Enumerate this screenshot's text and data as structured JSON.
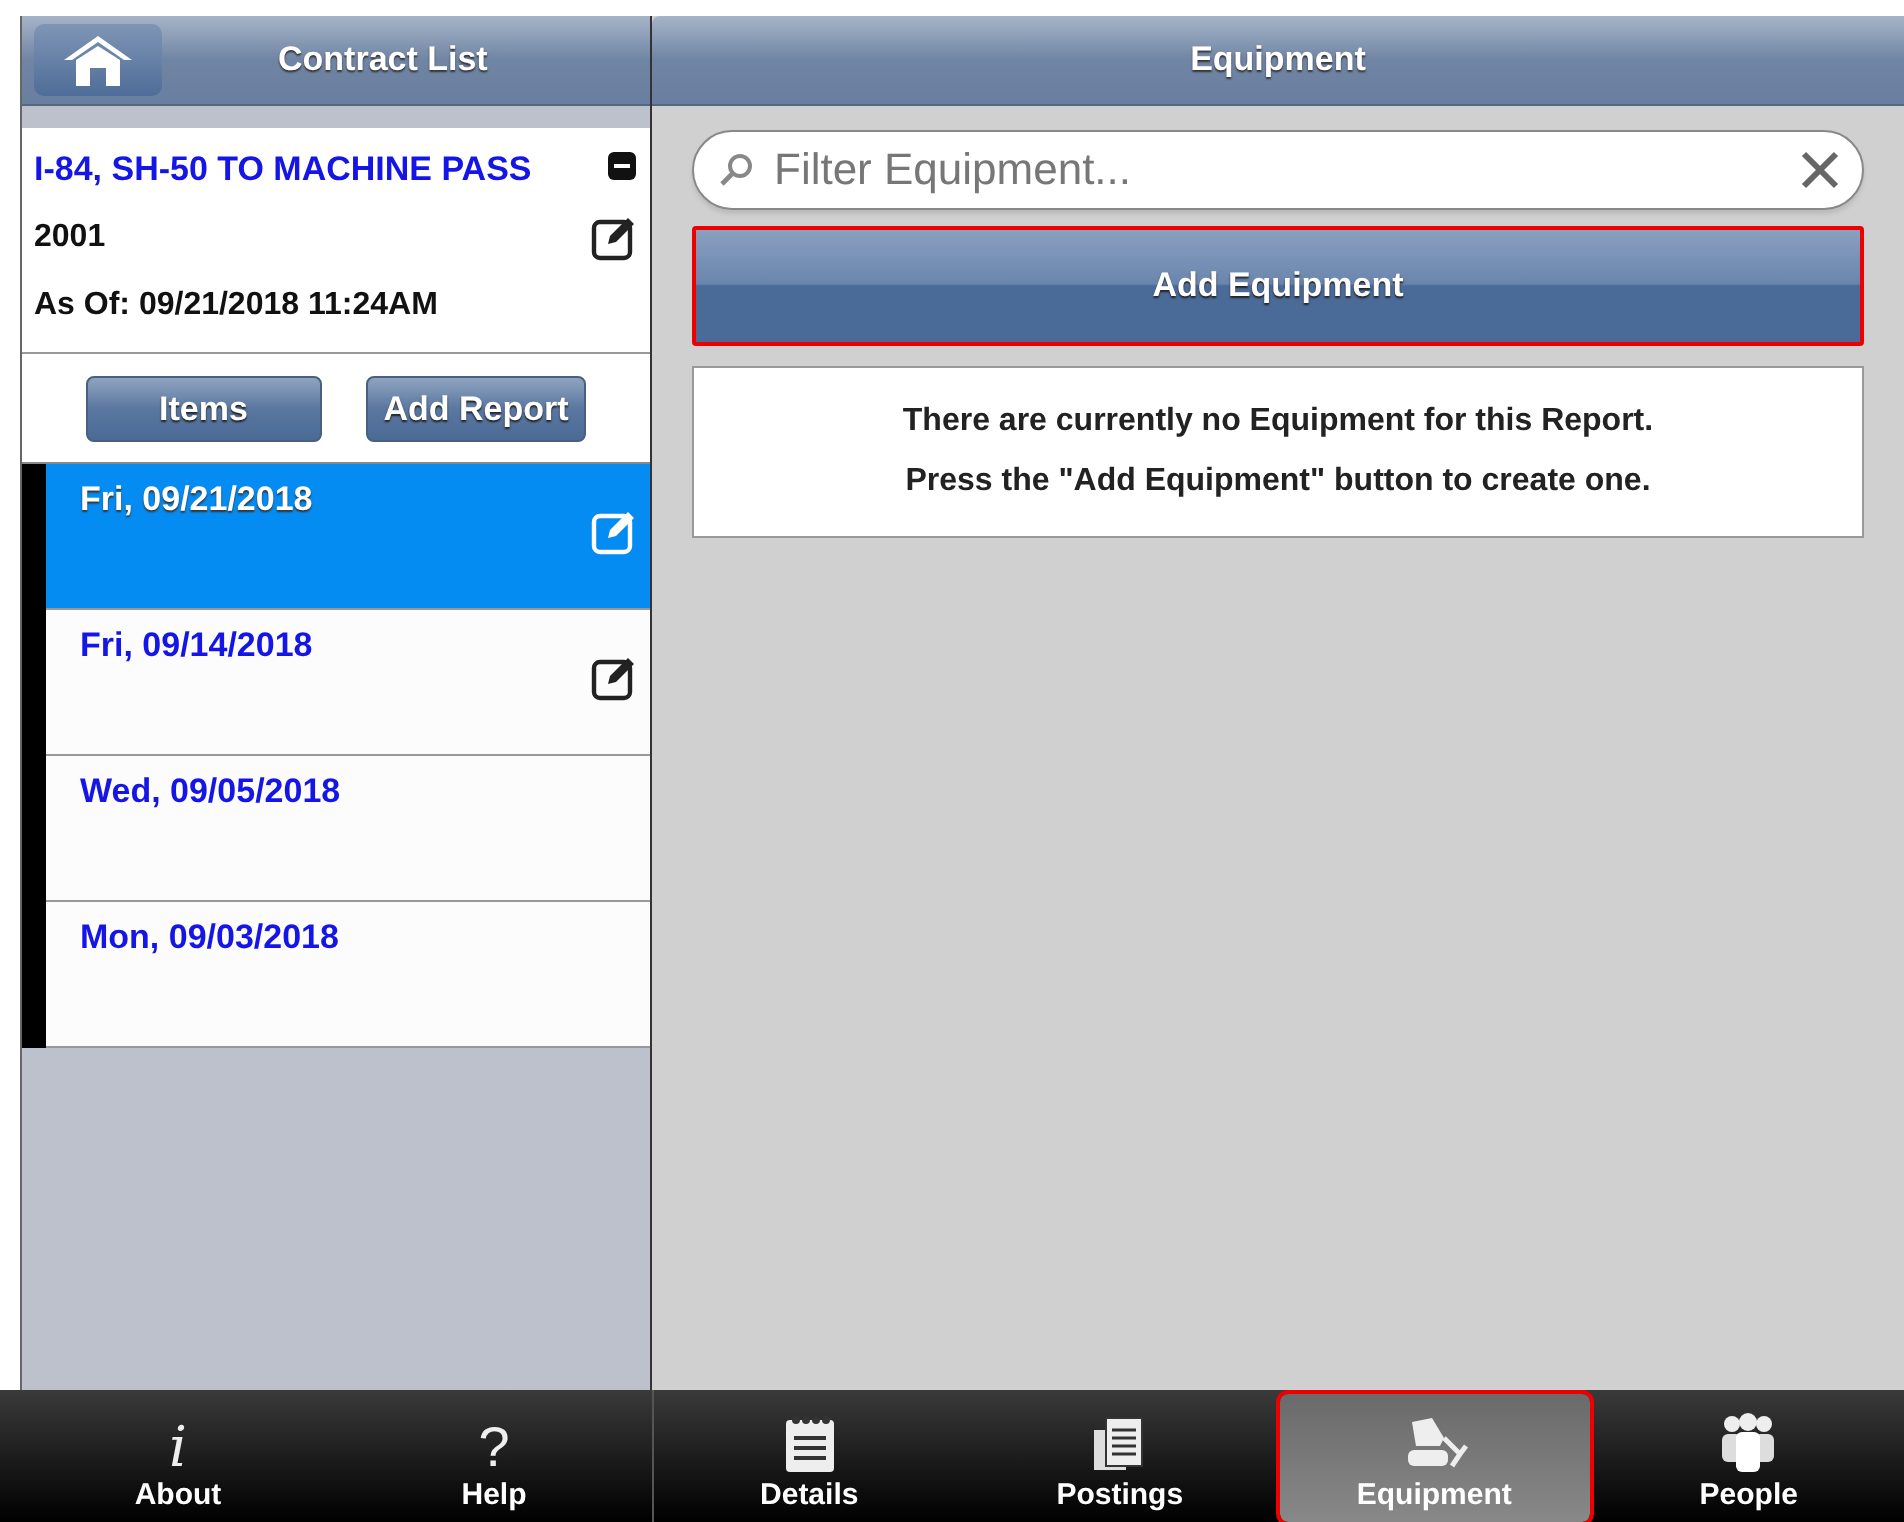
{
  "left_header": {
    "title": "Contract List"
  },
  "contract": {
    "name": "I-84, SH-50 TO MACHINE PASS",
    "number": "2001",
    "as_of": "As Of: 09/21/2018 11:24AM",
    "collapsed": false
  },
  "left_buttons": [
    "Items",
    "Add Report"
  ],
  "reports": [
    {
      "date": "Fri, 09/21/2018",
      "selected": true,
      "editable": true
    },
    {
      "date": "Fri, 09/14/2018",
      "selected": false,
      "editable": true
    },
    {
      "date": "Wed, 09/05/2018",
      "selected": false,
      "editable": false
    },
    {
      "date": "Mon, 09/03/2018",
      "selected": false,
      "editable": false
    }
  ],
  "right_header": {
    "title": "Equipment"
  },
  "filter": {
    "placeholder": "Filter Equipment..."
  },
  "add_button": {
    "label": "Add Equipment",
    "highlighted": true
  },
  "empty_message": [
    "There are currently no Equipment for this Report.",
    "Press the \"Add Equipment\" button to create one."
  ],
  "left_tabs": [
    {
      "glyph": "i",
      "label": "About"
    },
    {
      "glyph": "?",
      "label": "Help"
    }
  ],
  "right_tabs": [
    {
      "kind": "notepad",
      "label": "Details",
      "selected": false,
      "highlighted": false
    },
    {
      "kind": "documents",
      "label": "Postings",
      "selected": false,
      "highlighted": false
    },
    {
      "kind": "excavator",
      "label": "Equipment",
      "selected": true,
      "highlighted": true
    },
    {
      "kind": "people",
      "label": "People",
      "selected": false,
      "highlighted": false
    }
  ]
}
